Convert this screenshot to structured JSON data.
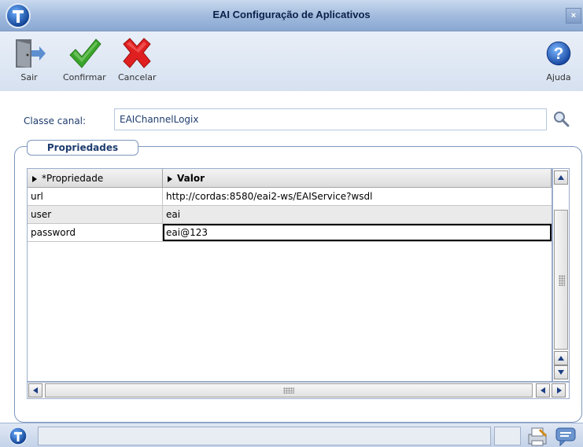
{
  "window": {
    "title": "EAI Configuração de Aplicativos",
    "close_glyph": "×"
  },
  "toolbar": {
    "sair": {
      "label": "Sair",
      "icon": "exit-door-icon"
    },
    "confirmar": {
      "label": "Confirmar",
      "icon": "checkmark-icon"
    },
    "cancelar": {
      "label": "Cancelar",
      "icon": "red-x-icon"
    },
    "ajuda": {
      "label": "Ajuda",
      "icon": "help-question-icon"
    }
  },
  "form": {
    "classe_canal_label": "Classe canal:",
    "classe_canal_value": "EAIChannelLogix"
  },
  "group": {
    "title": "Propriedades"
  },
  "grid": {
    "columns": [
      "*Propriedade",
      "Valor"
    ],
    "rows": [
      {
        "propriedade": "url",
        "valor": "http://cordas:8580/eai2-ws/EAIService?wsdl"
      },
      {
        "propriedade": "user",
        "valor": "eai"
      },
      {
        "propriedade": "password",
        "valor": "eai@123"
      }
    ]
  },
  "colors": {
    "title_text": "#0c1f4a",
    "accent_blue": "#1f3c6e",
    "cancel_red": "#e02020",
    "confirm_green": "#3aa52b"
  }
}
